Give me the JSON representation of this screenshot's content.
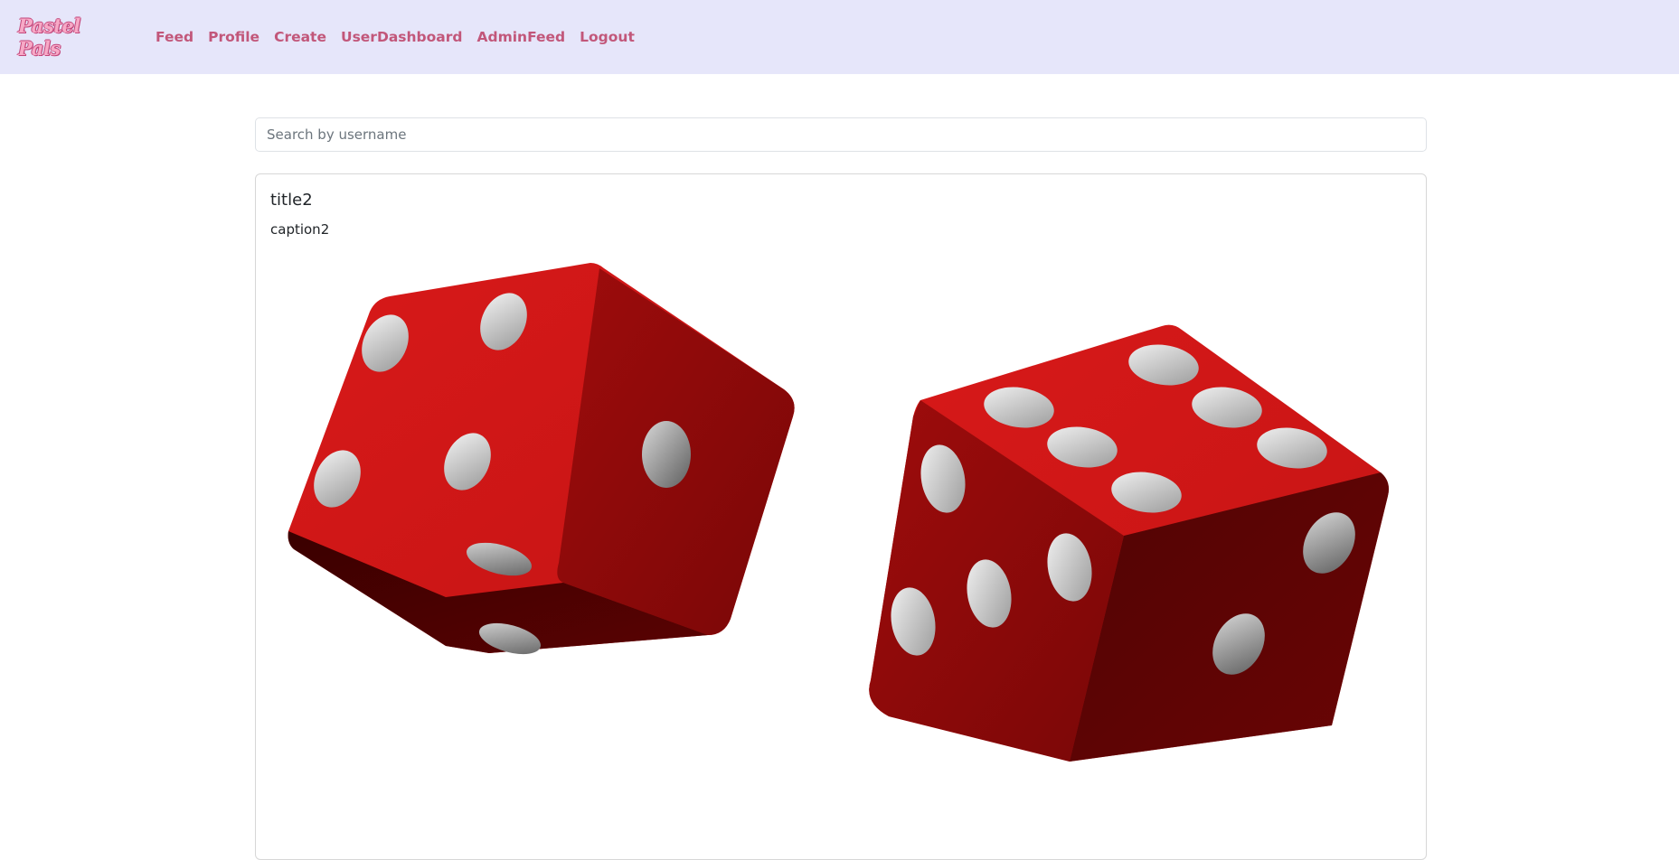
{
  "navbar": {
    "brand": "Pastel Pals",
    "links": [
      "Feed",
      "Profile",
      "Create",
      "UserDashboard",
      "AdminFeed",
      "Logout"
    ]
  },
  "search": {
    "placeholder": "Search by username",
    "value": ""
  },
  "post": {
    "title": "title2",
    "caption": "caption2",
    "image_icon": "red-dice-image"
  },
  "colors": {
    "navbar_bg": "#e6e6fa",
    "nav_link": "#c2577a",
    "brand": "#f7a9c6"
  }
}
